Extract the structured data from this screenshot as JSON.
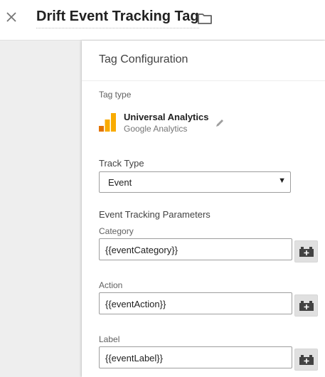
{
  "header": {
    "tag_name": "Drift Event Tracking Tag",
    "close_icon": "close-icon",
    "folder_icon": "folder-icon"
  },
  "card": {
    "title": "Tag Configuration",
    "tag_type": {
      "label": "Tag type",
      "name": "Universal Analytics",
      "provider": "Google Analytics",
      "logo_colors": [
        "#F9AB00",
        "#E37400"
      ]
    },
    "track_type": {
      "label": "Track Type",
      "value": "Event"
    },
    "params": {
      "heading": "Event Tracking Parameters",
      "category": {
        "label": "Category",
        "value": "{{eventCategory}}"
      },
      "action": {
        "label": "Action",
        "value": "{{eventAction}}"
      },
      "label": {
        "label": "Label",
        "value": "{{eventLabel}}"
      }
    }
  },
  "colors": {
    "background": "#eeeeee",
    "card": "#ffffff",
    "variable_button": "#e0e0e0"
  }
}
